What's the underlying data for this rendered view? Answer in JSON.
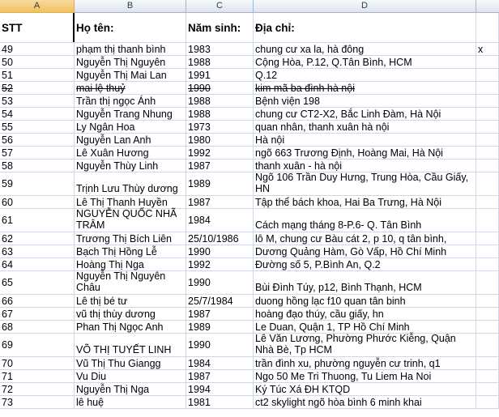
{
  "columns": [
    "A",
    "B",
    "C",
    "D"
  ],
  "header": {
    "stt": "STT",
    "name": "Họ tên:",
    "year": "Năm sinh:",
    "address": "Địa chỉ:"
  },
  "rows": [
    {
      "stt": "49",
      "name": "phạm thị thanh bình",
      "year": "1983",
      "address": " chung cư xa la, hà đông",
      "extra": "x"
    },
    {
      "stt": "50",
      "name": "Nguyễn Thị Nguyên",
      "year": "1988",
      "address": "Cộng Hòa, P.12, Q.Tân Bình, HCM",
      "extra": ""
    },
    {
      "stt": "51",
      "name": "Nguyễn Thị Mai Lan",
      "year": "1991",
      "address": "Q.12",
      "extra": ""
    },
    {
      "stt": "52",
      "name": "mai lệ thuỷ",
      "year": "1990",
      "address": "kim mã ba đình hà nội",
      "extra": "",
      "strike": true
    },
    {
      "stt": "53",
      "name": "Trần thị ngọc Ánh",
      "year": "1988",
      "address": "Bệnh viện 198",
      "extra": ""
    },
    {
      "stt": "54",
      "name": "Nguyễn Trang Nhung",
      "year": "1988",
      "address": "chung cư CT2-X2, Bắc Linh Đàm, Hà Nội",
      "extra": ""
    },
    {
      "stt": "55",
      "name": "Ly Ngân Hoa",
      "year": "1973",
      "address": "quan nhân, thanh xuân hà nội",
      "extra": ""
    },
    {
      "stt": "56",
      "name": "Nguyễn Lan Anh",
      "year": "1980",
      "address": "Hà nội",
      "extra": ""
    },
    {
      "stt": "57",
      "name": "Lê Xuân Hương",
      "year": "1992",
      "address": " ngõ 663 Trương Định, Hoàng Mai, Hà Nội",
      "extra": ""
    },
    {
      "stt": "58",
      "name": "Nguyễn Thùy Linh",
      "year": "1987",
      "address": "thanh xuân - hà nội",
      "extra": ""
    },
    {
      "stt": "59",
      "name": "Trịnh Lưu Thùy dương",
      "year": "1989",
      "address": "Ngõ 106 Trần Duy Hưng, Trung Hòa, Cầu Giấy, HN",
      "extra": "",
      "tall": true
    },
    {
      "stt": "60",
      "name": "Lê Thị Thanh Huyền",
      "year": "1987",
      "address": "Tập thể bách khoa, Hai Ba Trưng, Hà Nội",
      "extra": ""
    },
    {
      "stt": "61",
      "name": "NGUYỄN QUỐC NHÃ TRÂM",
      "year": "1984",
      "address": "Cách mạng tháng 8-P.6- Q. Tân Bình",
      "extra": "",
      "tall": true
    },
    {
      "stt": "62",
      "name": "Trương Thị Bích Liên",
      "year": "25/10/1986",
      "address": "lô M, chung cư Bàu cát 2, p 10, q tân bình,",
      "extra": ""
    },
    {
      "stt": "63",
      "name": "Bạch Thị Hồng Lễ",
      "year": "1990",
      "address": "Dương Quảng Hàm, Gò Vấp, Hồ Chí Minh",
      "extra": ""
    },
    {
      "stt": "64",
      "name": "Hoàng Thị Nga",
      "year": "1992",
      "address": "Đường số 5, P.Bình An, Q.2",
      "extra": ""
    },
    {
      "stt": "65",
      "name": "Nguyễn Thị Nguyên Châu",
      "year": "1990",
      "address": "Bùi Đình Túy, p12, Bình Thạnh, HCM",
      "extra": "",
      "tall": true
    },
    {
      "stt": "66",
      "name": "Lê thị bé tư",
      "year": "25/7/1984",
      "address": "duong hồng lạc f10 quan tân binh",
      "extra": ""
    },
    {
      "stt": "67",
      "name": "vũ thị thùy dương",
      "year": "1987",
      "address": "hoàng đạo thúy, cầu giấy, hn",
      "extra": ""
    },
    {
      "stt": "68",
      "name": "Phan Thị Ngọc Anh",
      "year": "1989",
      "address": "Le Duan, Quận 1, TP Hồ Chí Minh",
      "extra": ""
    },
    {
      "stt": "69",
      "name": "VÕ THỊ TUYẾT LINH",
      "year": "1990",
      "address": "Lê Văn Lương, Phường Phước Kiễng, Quận Nhà Bè, Tp HCM",
      "extra": "",
      "tall": true
    },
    {
      "stt": "70",
      "name": "Vũ Thị Thu Giangg",
      "year": "1984",
      "address": "trần đình xu, phường nguyễn cư trinh, q1",
      "extra": ""
    },
    {
      "stt": "71",
      "name": "Vu Diu",
      "year": "1987",
      "address": "Ngo 50 Me Tri Thuong, Tu Liem Ha Noi",
      "extra": ""
    },
    {
      "stt": "72",
      "name": "Nguyễn Thị Nga",
      "year": "1994",
      "address": "Ký Túc Xá ĐH KTQD",
      "extra": ""
    },
    {
      "stt": "73",
      "name": "lê huệ",
      "year": "1981",
      "address": " ct2 skylight ngõ hòa bình 6 minh khai",
      "extra": ""
    }
  ]
}
